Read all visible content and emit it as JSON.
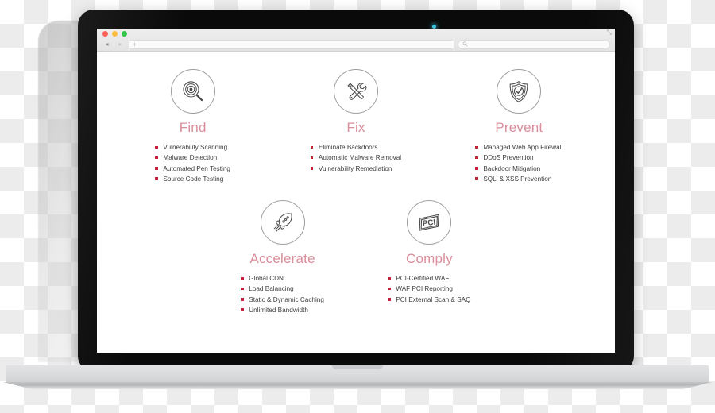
{
  "device": {
    "type": "laptop-mockup",
    "webcam_indicator_color": "#3fc4dd",
    "bezel_color": "#0a0a0a",
    "base_color": "#d9dadc"
  },
  "browser": {
    "traffic_lights": [
      {
        "name": "close",
        "color": "#fc6058"
      },
      {
        "name": "minimize",
        "color": "#fdbc40"
      },
      {
        "name": "maximize",
        "color": "#34c749"
      }
    ],
    "back_label": "◂",
    "forward_label": "▸",
    "new_tab_label": "+",
    "address_bar": {
      "value": "",
      "placeholder": ""
    },
    "search_bar": {
      "value": "",
      "placeholder": "",
      "icon": "search-icon"
    },
    "expand_label": "⤡"
  },
  "theme": {
    "title_color": "#d98f9b",
    "bullet_color": "#c4213a",
    "body_text_color": "#3d3d3d",
    "icon_stroke_color": "#4a4a4a",
    "icon_circle_color": "#9d9d9d"
  },
  "features": {
    "row1": [
      {
        "id": "find",
        "icon": "magnifier-target-icon",
        "title": "Find",
        "items": [
          "Vulnerability Scanning",
          "Malware Detection",
          "Automated Pen Testing",
          "Source Code Testing"
        ]
      },
      {
        "id": "fix",
        "icon": "screwdriver-wrench-icon",
        "title": "Fix",
        "items": [
          "Eliminate Backdoors",
          "Automatic Malware Removal",
          "Vulnerability Remediation"
        ]
      },
      {
        "id": "prevent",
        "icon": "shield-check-icon",
        "title": "Prevent",
        "items": [
          "Managed Web App Firewall",
          "DDoS Prevention",
          "Backdoor Mitigation",
          "SQLi & XSS Prevention"
        ]
      }
    ],
    "row2": [
      {
        "id": "accelerate",
        "icon": "rocket-icon",
        "title": "Accelerate",
        "items": [
          "Global CDN",
          "Load Balancing",
          "Static & Dynamic Caching",
          "Unlimited Bandwidth"
        ]
      },
      {
        "id": "comply",
        "icon": "pci-badge-icon",
        "title": "Comply",
        "items": [
          "PCI-Certified WAF",
          "WAF PCI Reporting",
          "PCI External Scan & SAQ"
        ]
      }
    ]
  }
}
